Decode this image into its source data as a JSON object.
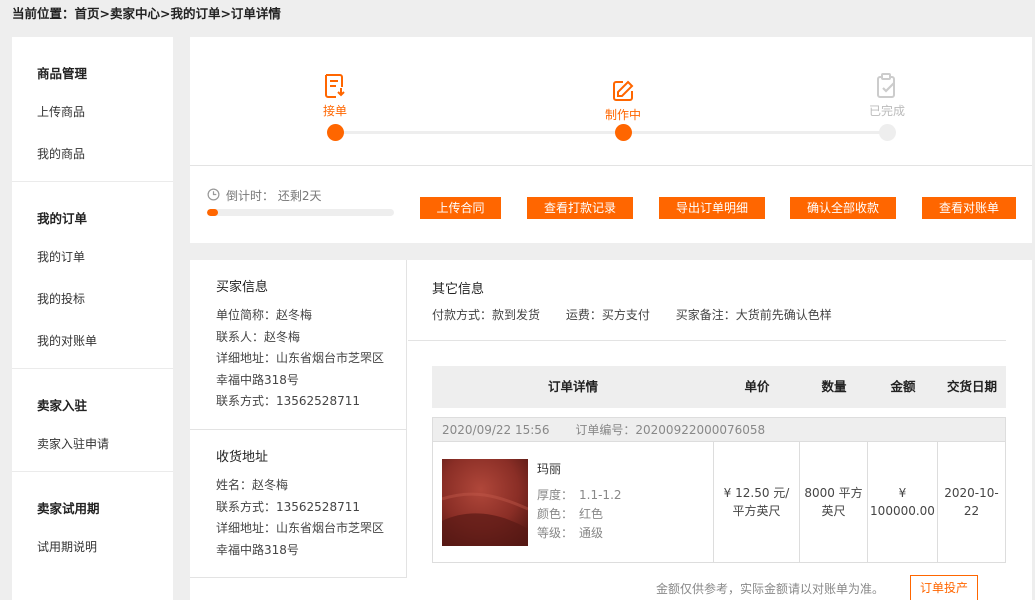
{
  "breadcrumb": "当前位置：首页>卖家中心>我的订单>订单详情",
  "sidebar": {
    "groups": [
      {
        "title": "商品管理",
        "items": [
          "上传商品",
          "我的商品"
        ]
      },
      {
        "title": "我的订单",
        "items": [
          "我的订单",
          "我的投标",
          "我的对账单"
        ]
      },
      {
        "title": "卖家入驻",
        "items": [
          "卖家入驻申请"
        ]
      },
      {
        "title": "卖家试用期",
        "items": [
          "试用期说明"
        ]
      }
    ]
  },
  "steps": [
    {
      "label": "接单",
      "state": "done",
      "icon": "receipt-icon"
    },
    {
      "label": "制作中",
      "state": "active",
      "icon": "edit-icon"
    },
    {
      "label": "已完成",
      "state": "pending",
      "icon": "clipboard-check-icon"
    }
  ],
  "countdown": {
    "label": "倒计时：  还剩2天",
    "progress": 0.06
  },
  "actions": [
    "上传合同",
    "查看打款记录",
    "导出订单明细",
    "确认全部收款",
    "查看对账单"
  ],
  "buyer": {
    "title": "买家信息",
    "lines": [
      "单位简称：赵冬梅",
      "联系人：赵冬梅",
      "详细地址：山东省烟台市芝罘区",
      "幸福中路318号",
      "联系方式：13562528711"
    ]
  },
  "shipping": {
    "title": "收货地址",
    "lines": [
      "姓名：赵冬梅",
      "联系方式：13562528711",
      "详细地址：山东省烟台市芝罘区",
      "幸福中路318号"
    ]
  },
  "other": {
    "title": "其它信息",
    "payment": "付款方式：款到发货",
    "freight": "运费：买方支付",
    "remark": "买家备注：大货前先确认色样"
  },
  "table": {
    "headers": [
      "订单详情",
      "单价",
      "数量",
      "金额",
      "交货日期"
    ],
    "order": {
      "time": "2020/09/22 15:56",
      "number": "订单编号：20200922000076058",
      "product_name": "玛丽",
      "attrs": [
        {
          "k": "厚度：",
          "v": "1.1-1.2"
        },
        {
          "k": "颜色：",
          "v": "红色"
        },
        {
          "k": "等级：",
          "v": "通级"
        }
      ],
      "unit_price": "¥ 12.50 元/平方英尺",
      "quantity": "8000 平方英尺",
      "amount": "¥ 100000.00",
      "delivery": "2020-10-22"
    }
  },
  "note": "金额仅供参考，实际金额请以对账单为准。",
  "production_button": "订单投产",
  "colors": {
    "accent": "#ff6600",
    "pending": "#cccccc"
  }
}
